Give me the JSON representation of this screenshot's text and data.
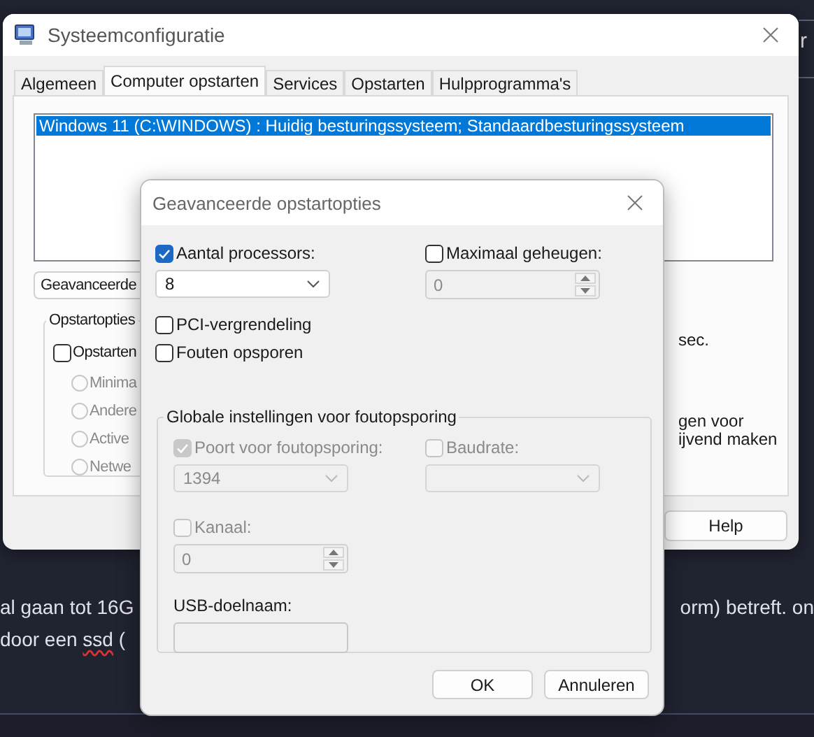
{
  "page": {
    "header_fragment": "r",
    "lines": [
      {
        "segments": [
          {
            "text": "al gaan tot 16G",
            "misspelled": false
          }
        ],
        "continuation": "orm) betreft. on"
      },
      {
        "segments": [
          {
            "text": "door een ",
            "misspelled": false
          },
          {
            "text": "ssd",
            "misspelled": true
          },
          {
            "text": " (",
            "misspelled": false
          }
        ]
      }
    ]
  },
  "system_config": {
    "title": "Systeemconfiguratie",
    "tabs": [
      {
        "label": "Algemeen",
        "selected": false
      },
      {
        "label": "Computer opstarten",
        "selected": true
      },
      {
        "label": "Services",
        "selected": false
      },
      {
        "label": "Opstarten",
        "selected": false
      },
      {
        "label": "Hulpprogramma's",
        "selected": false
      }
    ],
    "boot_list": [
      {
        "label": "Windows 11 (C:\\WINDOWS) : Huidig besturingssysteem; Standaardbesturingssysteem",
        "selected": true
      }
    ],
    "advanced_button": "Geavanceerde",
    "boot_options": {
      "title": "Opstartopties",
      "safe_boot": {
        "label": "Opstarten",
        "checked": false
      },
      "modes": [
        {
          "label": "Minima",
          "selected": false,
          "disabled": true
        },
        {
          "label": "Andere",
          "selected": false,
          "disabled": true
        },
        {
          "label": "Active",
          "selected": false,
          "disabled": true
        },
        {
          "label": "Netwe",
          "selected": false,
          "disabled": true
        }
      ]
    },
    "side_texts": [
      "sec.",
      "gen voor",
      "ijvend maken"
    ],
    "buttons": [
      "Help"
    ]
  },
  "advanced_dialog": {
    "title": "Geavanceerde opstartopties",
    "processors": {
      "label": "Aantal processors:",
      "checked": true,
      "value": "8"
    },
    "max_memory": {
      "label": "Maximaal geheugen:",
      "checked": false,
      "value": "0"
    },
    "pci_lock": {
      "label": "PCI-vergrendeling",
      "checked": false
    },
    "debug": {
      "label": "Fouten opsporen",
      "checked": false
    },
    "debug_settings": {
      "title": "Globale instellingen voor foutopsporing",
      "debug_port": {
        "label": "Poort voor foutopsporing:",
        "checked": true,
        "disabled": true,
        "value": "1394"
      },
      "baud_rate": {
        "label": "Baudrate:",
        "checked": false,
        "disabled": true
      },
      "channel": {
        "label": "Kanaal:",
        "checked": false,
        "disabled": true,
        "value": "0"
      },
      "usb_target": {
        "label": "USB-doelnaam:"
      }
    },
    "buttons": [
      "OK",
      "Annuleren"
    ]
  }
}
